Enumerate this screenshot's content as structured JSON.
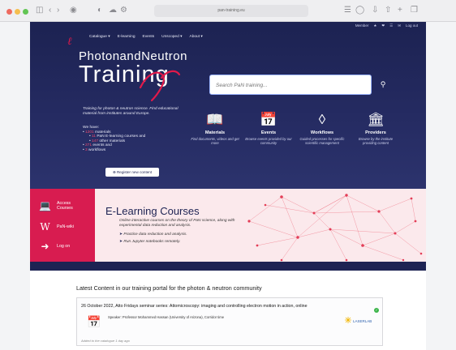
{
  "browser": {
    "url": "pan-training.eu"
  },
  "topnav": {
    "items": [
      "Member",
      "★",
      "❤",
      "☰",
      "✉",
      "Log out"
    ]
  },
  "site": {
    "menu": [
      "Catalogue ▾",
      "E-learning",
      "Events",
      "Unscoped ▾",
      "About ▾"
    ],
    "brand_line1": "PhotonandNeutron",
    "brand_line2": "Training",
    "description": "Training for photon & neutron science. Find educational material from institutes around Europe.",
    "we_have_label": "We have:",
    "we_have": [
      {
        "count": "1201",
        "text": "materials"
      },
      {
        "count": "11",
        "text": "PaN E-learning courses and"
      },
      {
        "count": "147",
        "text": "other materials"
      },
      {
        "count": "271",
        "text": "events and"
      },
      {
        "count": "3",
        "text": "workflows"
      }
    ],
    "register_button": "Register new content"
  },
  "search": {
    "placeholder": "Search PaN training..."
  },
  "categories": [
    {
      "title": "Materials",
      "desc": "Find documents, videos and get more",
      "icon": "book-icon"
    },
    {
      "title": "Events",
      "desc": "Browse events provided by our community",
      "icon": "calendar-icon"
    },
    {
      "title": "Workflows",
      "desc": "Guided processes for specific scientific management",
      "icon": "workflow-icon"
    },
    {
      "title": "Providers",
      "desc": "Browse by the institute providing content",
      "icon": "institution-icon"
    }
  ],
  "banner": {
    "side": [
      {
        "label": "Access Courses",
        "icon": "laptop-icon"
      },
      {
        "label": "PaN-wiki",
        "icon": "wikipedia-icon"
      },
      {
        "label": "Log on",
        "icon": "login-icon"
      }
    ],
    "title": "E-Learning Courses",
    "line": "Online interactive courses on the theory of PaN science, along with experimental data reduction and analysis.",
    "bullets": [
      "Practice data reduction and analysis.",
      "Run Jupyter notebooks remotely."
    ]
  },
  "latest": {
    "heading": "Latest Content in our training portal for the photon & neutron community",
    "card": {
      "title": "26 October 2022, Atto Fridays seminar series: Attomicroscopy: imaging and controlling electron motion in action, online",
      "speaker": "Speaker: Professor Mohammed Hassan (University of Arizona), Corridor time",
      "added": "Added to the catalogue 1 day ago",
      "logo_text": "LASERLAB"
    }
  },
  "colors": {
    "navy": "#1d2353",
    "accent_red": "#d81c50",
    "banner_bg": "#fbe9ec"
  }
}
